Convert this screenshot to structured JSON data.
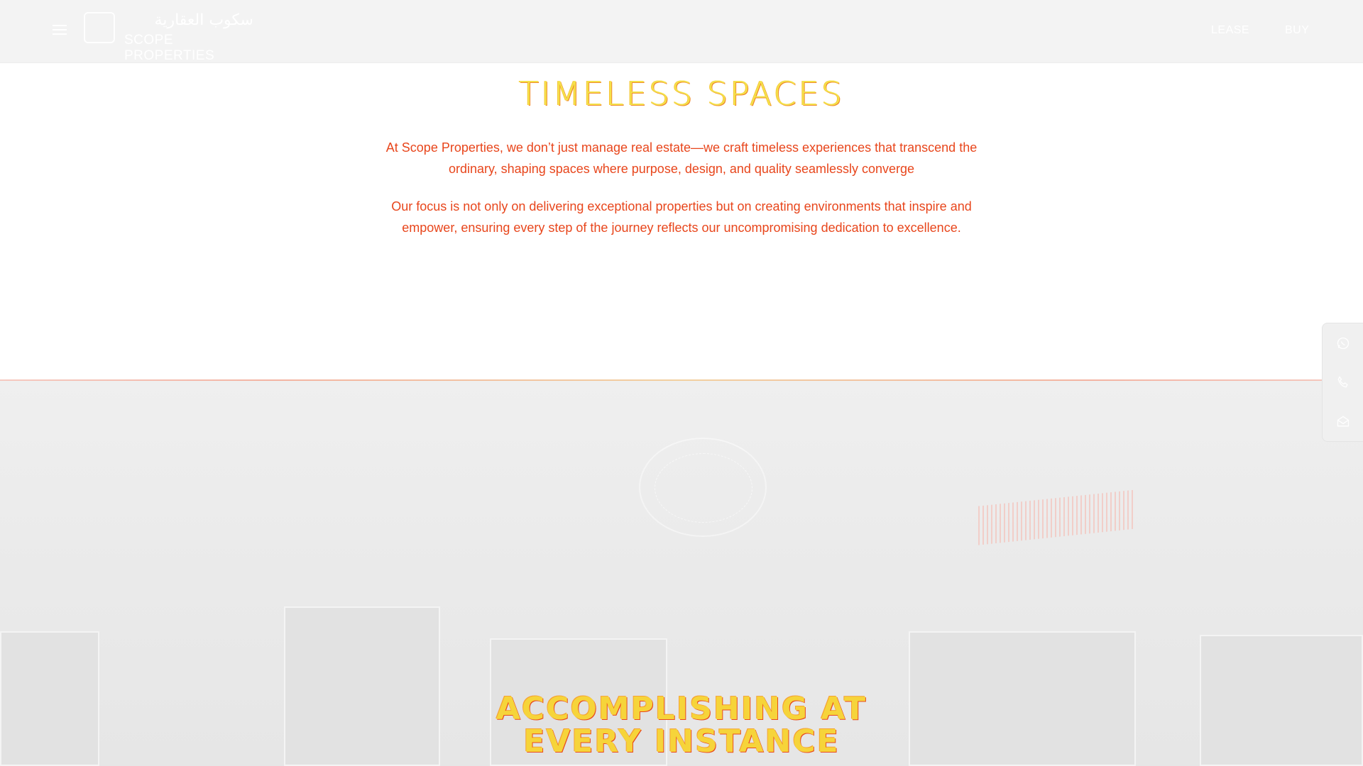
{
  "header": {
    "logo_arabic": "سكوب العقارية",
    "logo_english": "SCOPE PROPERTIES",
    "nav": [
      {
        "label": "LEASE"
      },
      {
        "label": "BUY"
      }
    ]
  },
  "intro": {
    "title": "TIMELESS SPACES",
    "paragraph_1": "At Scope Properties, we don’t just manage real estate—we craft timeless experiences that transcend the ordinary, shaping spaces where purpose, design, and quality seamlessly converge",
    "paragraph_2": "Our focus is not only on delivering exceptional properties but on creating environments that inspire and empower, ensuring every step of the journey reflects our uncompromising dedication to excellence."
  },
  "hero": {
    "title_line_1": "ACCOMPLISHING AT",
    "title_line_2": "EVERY INSTANCE"
  },
  "contact_bar": {
    "items": [
      "whatsapp-icon",
      "phone-icon",
      "mail-icon"
    ]
  },
  "colors": {
    "header_bg": "#f3f3f3",
    "title_yellow": "#f4e24a",
    "body_text": "#e8461c",
    "hero_bg": "#ebebeb"
  }
}
